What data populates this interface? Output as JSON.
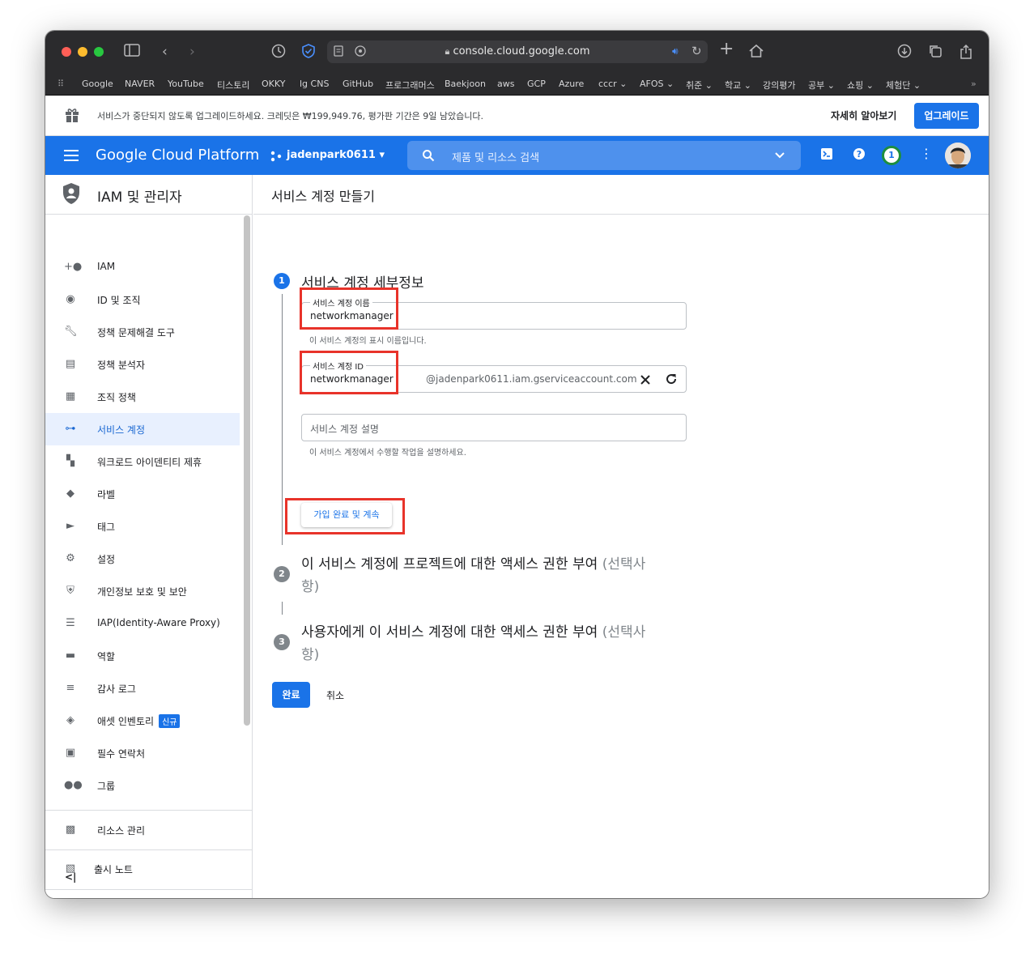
{
  "browser": {
    "url": "console.cloud.google.com",
    "bookmarks": [
      "Google",
      "NAVER",
      "YouTube",
      "티스토리",
      "OKKY",
      "lg CNS",
      "GitHub",
      "프로그래머스",
      "Baekjoon",
      "aws",
      "GCP",
      "Azure",
      "cccr",
      "AFOS",
      "취준",
      "학교",
      "강의평가",
      "공부",
      "쇼핑",
      "체험단"
    ]
  },
  "banner": {
    "text": "서비스가 중단되지 않도록 업그레이드하세요. 크레딧은 ₩199,949.76, 평가판 기간은 9일 남았습니다.",
    "learn_more": "자세히 알아보기",
    "upgrade": "업그레이드"
  },
  "header": {
    "title": "Google Cloud Platform",
    "project": "jadenpark0611",
    "search_placeholder": "제품 및 리소스 검색",
    "notification_count": "1"
  },
  "sidebar": {
    "title": "IAM 및 관리자",
    "items": [
      {
        "label": "IAM",
        "icon": "person-add-icon"
      },
      {
        "label": "ID 및 조직",
        "icon": "account-circle-icon"
      },
      {
        "label": "정책 문제해결 도구",
        "icon": "wrench-icon"
      },
      {
        "label": "정책 분석자",
        "icon": "policy-analyzer-icon"
      },
      {
        "label": "조직 정책",
        "icon": "document-icon"
      },
      {
        "label": "서비스 계정",
        "icon": "service-account-icon"
      },
      {
        "label": "워크로드 아이덴티티 제휴",
        "icon": "workload-icon"
      },
      {
        "label": "라벨",
        "icon": "label-icon"
      },
      {
        "label": "태그",
        "icon": "tag-icon"
      },
      {
        "label": "설정",
        "icon": "gear-icon"
      },
      {
        "label": "개인정보 보호 및 보안",
        "icon": "shield-icon"
      },
      {
        "label": "IAP(Identity-Aware Proxy)",
        "icon": "iap-icon"
      },
      {
        "label": "역할",
        "icon": "hat-icon"
      },
      {
        "label": "감사 로그",
        "icon": "list-icon"
      },
      {
        "label": "애셋 인벤토리",
        "icon": "diamond-icon",
        "badge": "신규"
      },
      {
        "label": "필수 연락처",
        "icon": "contact-icon"
      },
      {
        "label": "그룹",
        "icon": "group-icon"
      }
    ],
    "resource_mgmt": "리소스 관리",
    "release_notes": "출시 노트",
    "collapse": "<|"
  },
  "main": {
    "page_title": "서비스 계정 만들기",
    "step1": {
      "num": "1",
      "title": "서비스 계정 세부정보",
      "name_label": "서비스 계정 이름",
      "name_value": "networkmanager",
      "name_helper": "이 서비스 계정의 표시 이름입니다.",
      "id_label": "서비스 계정 ID",
      "id_value": "networkmanager",
      "id_suffix": "@jadenpark0611.iam.gserviceaccount.com",
      "desc_placeholder": "서비스 계정 설명",
      "desc_helper": "이 서비스 계정에서 수행할 작업을 설명하세요.",
      "continue_button": "가입 완료 및 계속"
    },
    "step2": {
      "num": "2",
      "title_line1": "이 서비스 계정에 프로젝트에 대한 액세스 권한 부여",
      "optional_a": "(선택사",
      "optional_b": "항)"
    },
    "step3": {
      "num": "3",
      "title_line1": "사용자에게 이 서비스 계정에 대한 액세스 권한 부여",
      "optional_a": "(선택사",
      "optional_b": "항)"
    },
    "done_button": "완료",
    "cancel_button": "취소"
  },
  "colors": {
    "accent": "#1a73e8",
    "highlight_box": "#e8332a",
    "step_active": "#1a73e8",
    "step_inactive": "#80868b"
  }
}
